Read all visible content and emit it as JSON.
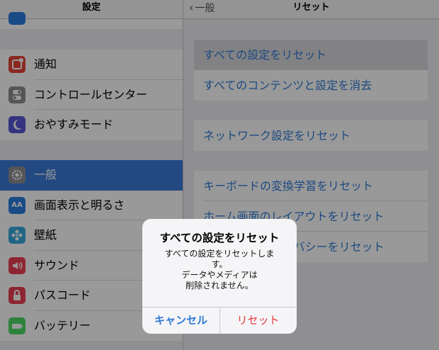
{
  "sidebar": {
    "title": "設定",
    "groups": [
      [
        {
          "label": "通知",
          "icon": "notification-icon",
          "color": "#e8443a"
        },
        {
          "label": "コントロールセンター",
          "icon": "control-center-icon",
          "color": "#8e8e93"
        },
        {
          "label": "おやすみモード",
          "icon": "moon-icon",
          "color": "#5856d6"
        }
      ],
      [
        {
          "label": "一般",
          "icon": "gear-icon",
          "color": "#8e8e93"
        },
        {
          "label": "画面表示と明るさ",
          "icon": "text-size-icon",
          "color": "#2a7de1"
        },
        {
          "label": "壁紙",
          "icon": "wallpaper-icon",
          "color": "#36aadc"
        },
        {
          "label": "サウンド",
          "icon": "speaker-icon",
          "color": "#ee3c52"
        },
        {
          "label": "パスコード",
          "icon": "lock-icon",
          "color": "#ee3c52"
        },
        {
          "label": "バッテリー",
          "icon": "battery-icon",
          "color": "#4cd964"
        }
      ]
    ],
    "selected": "一般"
  },
  "detail": {
    "back_label": "一般",
    "title": "リセット",
    "groups": [
      [
        "すべての設定をリセット",
        "すべてのコンテンツと設定を消去"
      ],
      [
        "ネットワーク設定をリセット"
      ],
      [
        "キーボードの変換学習をリセット",
        "ホーム画面のレイアウトをリセット",
        "位置情報とプライバシーをリセット"
      ]
    ]
  },
  "alert": {
    "title": "すべての設定をリセット",
    "message_lines": [
      "すべての設定をリセットしま",
      "す。",
      "データやメディアは",
      "削除されません。"
    ],
    "cancel_label": "キャンセル",
    "confirm_label": "リセット"
  },
  "colors": {
    "accent": "#2f7ad6",
    "destructive": "#e0393e",
    "selected_row": "#3b7bd9"
  }
}
